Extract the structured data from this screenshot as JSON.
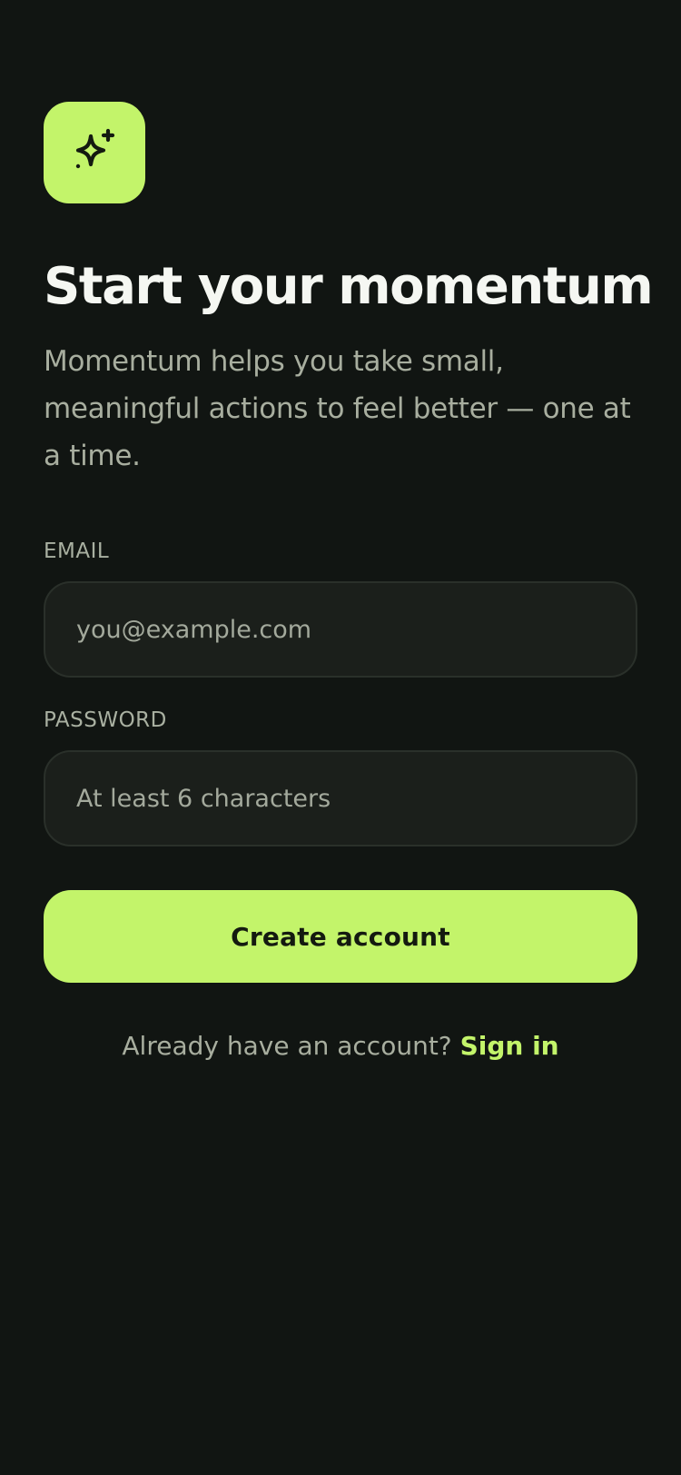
{
  "brand": {
    "icon": "sparkles-icon",
    "accent_color": "#c3f46a",
    "background_color": "#111512"
  },
  "header": {
    "title": "Start your momentum",
    "subtitle": "Momentum helps you take small, meaningful actions to feel better — one at a time."
  },
  "form": {
    "email": {
      "label": "EMAIL",
      "value": "",
      "placeholder": "you@example.com"
    },
    "password": {
      "label": "PASSWORD",
      "value": "",
      "placeholder": "At least 6 characters"
    },
    "submit_label": "Create account"
  },
  "footer": {
    "prompt": "Already have an account?",
    "link_label": "Sign in"
  }
}
